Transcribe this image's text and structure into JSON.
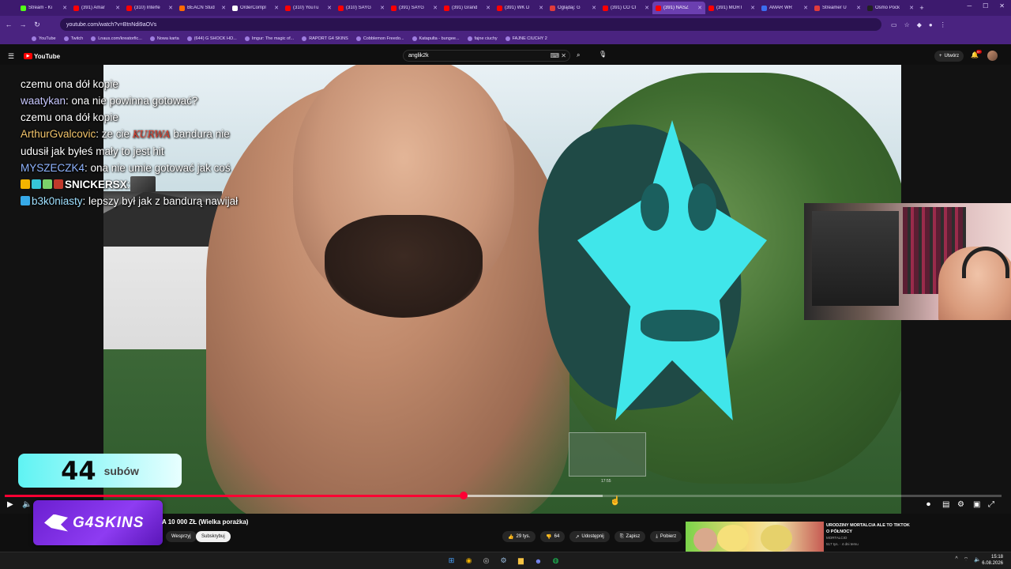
{
  "browser": {
    "tabs": [
      {
        "label": "Stream - Ki",
        "color": "#53fc18"
      },
      {
        "label": "(391) Amar",
        "color": "#ff0000"
      },
      {
        "label": "(310) Interfe",
        "color": "#ff0000"
      },
      {
        "label": "BEACN Stud",
        "color": "#ff6a00"
      },
      {
        "label": "OrderCompl",
        "color": "#ffffff"
      },
      {
        "label": "(310) YouTu",
        "color": "#ff0000"
      },
      {
        "label": "(310) SAYG",
        "color": "#ff0000"
      },
      {
        "label": "(391) SAYG",
        "color": "#ff0000"
      },
      {
        "label": "(391) Grand",
        "color": "#ff0000"
      },
      {
        "label": "(391) WK D",
        "color": "#ff0000"
      },
      {
        "label": "Oglądaj: G",
        "color": "#e03b3b"
      },
      {
        "label": "(391) CO CI",
        "color": "#ff0000"
      },
      {
        "label": "(391) NASZ",
        "color": "#ff0000",
        "active": true
      },
      {
        "label": "(391) MORT",
        "color": "#ff0000"
      },
      {
        "label": "AMAR WR",
        "color": "#3b6df0"
      },
      {
        "label": "Streamer U",
        "color": "#e03b3b"
      },
      {
        "label": "Osmo Pock",
        "color": "#222222"
      }
    ],
    "url": "youtube.com/watch?v=BtnNdi9aOVs",
    "bookmarks": [
      "YouTube",
      "Twitch",
      "Lnaus.com/kreatorfic...",
      "Nowa karta",
      "(644) G SHOCK HO...",
      "Imgur: The magic of...",
      "RAPORT G4 SKINS",
      "Cobblemon Freedo...",
      "Katapulta - bungee...",
      "fajne ciuchy",
      "FAJNE CIUCHY 2"
    ]
  },
  "youtube": {
    "logo": "YouTube",
    "search_value": "anglik2k",
    "create_label": "Utwórz",
    "notif_count": "9+",
    "video_title": "A 10 000 ZŁ (Wielka porażka)",
    "support_label": "Wesprzyj",
    "subscribe_label": "Subskrybuj",
    "likes": "29 tys.",
    "dislikes": "64",
    "share_label": "Udostępnij",
    "save_label": "Zapisz",
    "download_label": "Pobierz",
    "hover_time": "17:55",
    "progress_fraction": 0.46,
    "hover_fraction": 0.6,
    "recommendation": {
      "title": "URODZINY MORTALCIA ALE TO TIKTOK O PÓŁNOCY",
      "channel": "MORTALCIO",
      "meta": "517 tys. · 4 dni temu"
    }
  },
  "chat": [
    {
      "user": "",
      "text": "czemu ona dół kopie",
      "ucls": "u1"
    },
    {
      "user": "waatykan",
      "text": ": ona nie powinna gotować?",
      "ucls": "u1"
    },
    {
      "user": "",
      "text": "czemu ona dół kopie",
      "ucls": "u1"
    },
    {
      "user": "ArthurGvalcovic",
      "kw": "KURWA",
      "text": " bandura nie udusił jak byłeś mały to jest hit",
      "pre": ": ze cie ",
      "ucls": "u2"
    },
    {
      "user": "MYSZECZK4",
      "text": ": ona nie umie gotować jak coś",
      "ucls": "u3"
    },
    {
      "user": "SNICKERSX",
      "text": ":",
      "ucls": "u4"
    },
    {
      "user": "b3k0niasty",
      "text": ": lepszy był jak z bandurą nawijał",
      "ucls": "u5"
    }
  ],
  "sub_counter": {
    "count": "44",
    "label": "subów"
  },
  "sponsor": {
    "name": "G4SKINS"
  },
  "taskbar": {
    "time": "15:18",
    "date": "6.08.2026"
  },
  "colors": {
    "brand_purple": "#6b1fd0",
    "progress_red": "#ff0033",
    "sub_cyan": "#5ff3f3",
    "sprite_cyan": "#40e6ea"
  }
}
